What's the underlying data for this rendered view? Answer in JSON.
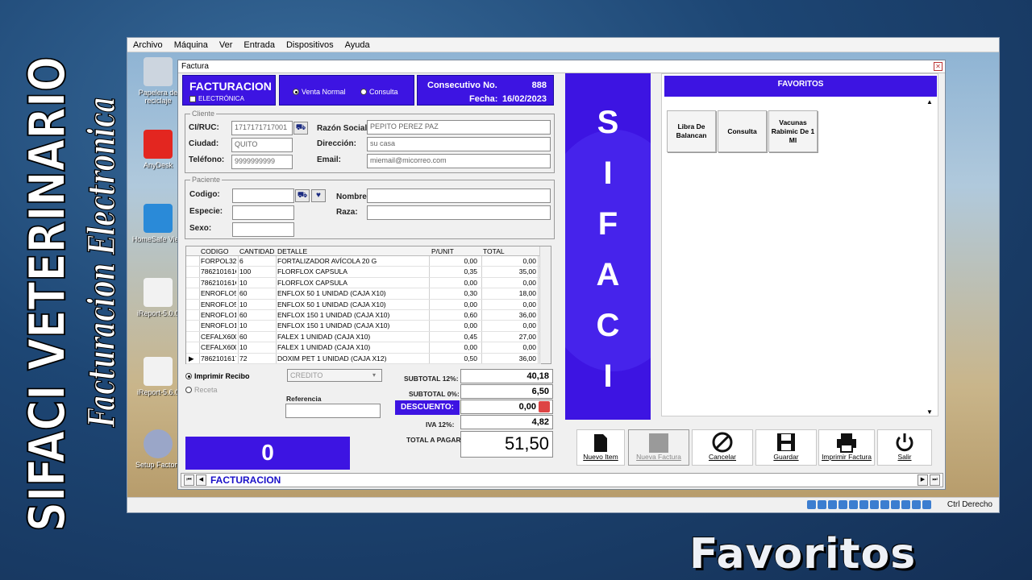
{
  "overlay": {
    "side_title_line1": "SIFACI VETERINARIO",
    "side_title_line2": "Facturacion Electronica",
    "caption": "Favoritos"
  },
  "vm": {
    "menu": [
      "Archivo",
      "Máquina",
      "Ver",
      "Entrada",
      "Dispositivos",
      "Ayuda"
    ],
    "status_right": "Ctrl Derecho",
    "desktop_icons": [
      "Papelera de reciclaje",
      "AnyDesk",
      "HomeSafe View",
      "iReport-5.0.0",
      "iReport-5.6.0",
      "Setup Factory"
    ]
  },
  "window": {
    "title": "Factura",
    "header": {
      "title": "FACTURACION",
      "electronic_label": "ELECTRÓNICA",
      "radio_sale": "Venta Normal",
      "radio_query": "Consulta",
      "consecutive_label": "Consecutivo  No.",
      "consecutive_value": "888",
      "date_label": "Fecha:",
      "date_value": "16/02/2023"
    },
    "client": {
      "legend": "Cliente",
      "ruc_label": "CI/RUC:",
      "ruc_value": "1717171717001",
      "name_label": "Razón Social:",
      "name_value": "PEPITO PEREZ PAZ",
      "city_label": "Ciudad:",
      "city_value": "QUITO",
      "address_label": "Dirección:",
      "address_value": "su casa",
      "phone_label": "Teléfono:",
      "phone_value": "9999999999",
      "email_label": "Email:",
      "email_value": "miemail@micorreo.com"
    },
    "patient": {
      "legend": "Paciente",
      "code_label": "Codigo:",
      "species_label": "Especie:",
      "sex_label": "Sexo:",
      "name_label": "Nombre:",
      "breed_label": "Raza:"
    },
    "grid": {
      "headers": [
        "CODIGO",
        "CANTIDAD",
        "DETALLE",
        "P/UNIT",
        "TOTAL"
      ],
      "rows": [
        {
          "code": "FORPOL324",
          "qty": "6",
          "detail": "FORTALIZADOR AVÍCOLA 20 G",
          "unit": "0,00",
          "total": "0,00"
        },
        {
          "code": "786210161€",
          "qty": "100",
          "detail": "FLORFLOX  CAPSULA",
          "unit": "0,35",
          "total": "35,00"
        },
        {
          "code": "786210161€",
          "qty": "10",
          "detail": "FLORFLOX  CAPSULA",
          "unit": "0,00",
          "total": "0,00"
        },
        {
          "code": "ENROFLO5(",
          "qty": "60",
          "detail": "ENFLOX 50 1 UNIDAD (CAJA X10)",
          "unit": "0,30",
          "total": "18,00"
        },
        {
          "code": "ENROFLO5(",
          "qty": "10",
          "detail": "ENFLOX 50 1 UNIDAD (CAJA X10)",
          "unit": "0,00",
          "total": "0,00"
        },
        {
          "code": "ENROFLO15",
          "qty": "60",
          "detail": "ENFLOX 150 1 UNIDAD (CAJA X10)",
          "unit": "0,60",
          "total": "36,00"
        },
        {
          "code": "ENROFLO15",
          "qty": "10",
          "detail": "ENFLOX 150 1 UNIDAD (CAJA X10)",
          "unit": "0,00",
          "total": "0,00"
        },
        {
          "code": "CEFALX600",
          "qty": "60",
          "detail": "FALEX 1 UNIDAD (CAJA X10)",
          "unit": "0,45",
          "total": "27,00"
        },
        {
          "code": "CEFALX600",
          "qty": "10",
          "detail": "FALEX 1 UNIDAD (CAJA X10)",
          "unit": "0,00",
          "total": "0,00"
        },
        {
          "code": "78621016172",
          "qty": "72",
          "detail": "DOXIM PET 1 UNIDAD (CAJA X12)",
          "unit": "0,50",
          "total": "36,00"
        }
      ]
    },
    "options": {
      "print_receipt": "Imprimir Recibo",
      "prescription": "Receta",
      "payment_method": "CREDITO",
      "reference_label": "Referencia"
    },
    "totals": {
      "subtotal12_label": "SUBTOTAL  12%:",
      "subtotal12_value": "40,18",
      "subtotal0_label": "SUBTOTAL 0%:",
      "subtotal0_value": "6,50",
      "discount_label": "DESCUENTO:",
      "discount_value": "0,00",
      "iva_label": "IVA  12%:",
      "iva_value": "4,82",
      "total_label": "TOTAL A PAGAR:",
      "total_value": "51,50"
    },
    "counter": "0",
    "brand_letters": [
      "S",
      "I",
      "F",
      "A",
      "C",
      "I"
    ],
    "favorites": {
      "title": "FAVORITOS",
      "items": [
        "Libra De Balancan",
        "Consulta",
        "Vacunas Rabimic De 1 Ml"
      ]
    },
    "actions": {
      "new_item": "Nuevo Item",
      "new_invoice": "Nueva Factura",
      "cancel": "Cancelar",
      "save": "Guardar",
      "print": "Imprimir Factura",
      "exit": "Salir"
    },
    "nav_label": "FACTURACION"
  }
}
